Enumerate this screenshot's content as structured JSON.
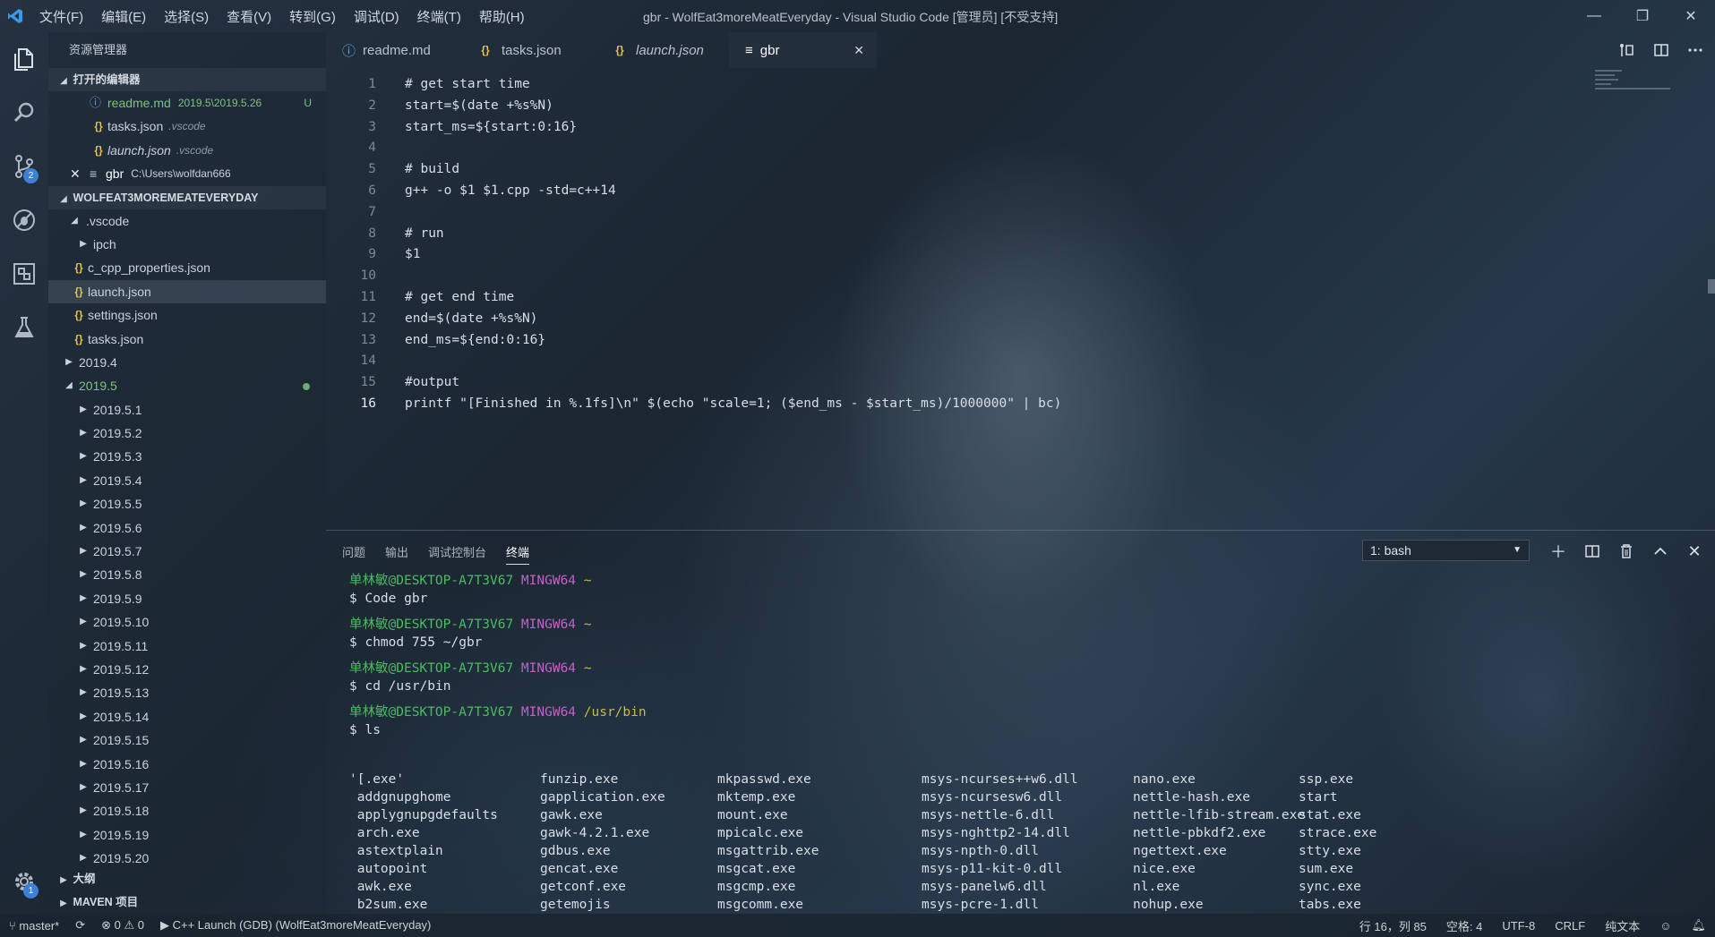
{
  "titlebar": {
    "logo": "vscode-logo",
    "menu": [
      "文件(F)",
      "编辑(E)",
      "选择(S)",
      "查看(V)",
      "转到(G)",
      "调试(D)",
      "终端(T)",
      "帮助(H)"
    ],
    "title": "gbr - WolfEat3moreMeatEveryday - Visual Studio Code [管理员] [不受支持]",
    "win": [
      "—",
      "❐",
      "✕"
    ]
  },
  "activity": {
    "scm_badge": "2",
    "settings_badge": "1"
  },
  "sidebar": {
    "header": "资源管理器",
    "open_editors": {
      "label": "打开的编辑器",
      "items": [
        {
          "name": "readme.md",
          "detail": "2019.5\\2019.5.26",
          "flag": "U"
        },
        {
          "name": "tasks.json",
          "detail": ".vscode"
        },
        {
          "name": "launch.json",
          "detail": ".vscode"
        },
        {
          "name": "gbr",
          "detail": "C:\\Users\\wolfdan666",
          "close": "✕"
        }
      ]
    },
    "workspace": {
      "label": "WOLFEAT3MOREMEATEVERYDAY",
      "items": [
        ".vscode",
        "ipch",
        "c_cpp_properties.json",
        "launch.json",
        "settings.json",
        "tasks.json",
        "2019.4",
        "2019.5",
        "2019.5.1",
        "2019.5.2",
        "2019.5.3",
        "2019.5.4",
        "2019.5.5",
        "2019.5.6",
        "2019.5.7",
        "2019.5.8",
        "2019.5.9",
        "2019.5.10",
        "2019.5.11",
        "2019.5.12",
        "2019.5.13",
        "2019.5.14",
        "2019.5.15",
        "2019.5.16",
        "2019.5.17",
        "2019.5.18",
        "2019.5.19",
        "2019.5.20"
      ]
    },
    "outline": "大纲",
    "maven": "MAVEN 项目"
  },
  "tabs": [
    {
      "label": "readme.md",
      "icon": "info-icon"
    },
    {
      "label": "tasks.json",
      "icon": "json-icon"
    },
    {
      "label": "launch.json",
      "icon": "json-icon"
    },
    {
      "label": "gbr",
      "icon": "file-icon",
      "close": "✕"
    }
  ],
  "editor": {
    "lines": [
      "# get start time",
      "start=$(date +%s%N)",
      "start_ms=${start:0:16}",
      "",
      "# build",
      "g++ -o $1 $1.cpp -std=c++14",
      "",
      "# run",
      "$1",
      "",
      "# get end time",
      "end=$(date +%s%N)",
      "end_ms=${end:0:16}",
      "",
      "#output",
      "printf \"[Finished in %.1fs]\\n\" $(echo \"scale=1; ($end_ms - $start_ms)/1000000\" | bc)"
    ],
    "numbers": [
      "1",
      "2",
      "3",
      "4",
      "5",
      "6",
      "7",
      "8",
      "9",
      "10",
      "11",
      "12",
      "13",
      "14",
      "15",
      "16"
    ]
  },
  "panel": {
    "tabs": [
      "问题",
      "输出",
      "调试控制台",
      "终端"
    ],
    "terminal_select": "1: bash",
    "prompt_user": "单林敏@DESKTOP-A7T3V67",
    "prompt_env": "MINGW64",
    "sessions": [
      {
        "dir": "~",
        "cmd": "$ Code gbr"
      },
      {
        "dir": "~",
        "cmd": "$ chmod 755 ~/gbr"
      },
      {
        "dir": "~",
        "cmd": "$ cd /usr/bin"
      },
      {
        "dir": "/usr/bin",
        "cmd": "$ ls"
      }
    ],
    "ls": [
      [
        "'[.exe'",
        " addgnupghome",
        " applygnupgdefaults",
        " arch.exe",
        " astextplain",
        " autopoint",
        " awk.exe",
        " b2sum.exe"
      ],
      [
        "funzip.exe",
        "gapplication.exe",
        "gawk.exe",
        "gawk-4.2.1.exe",
        "gdbus.exe",
        "gencat.exe",
        "getconf.exe",
        "getemojis"
      ],
      [
        "mkpasswd.exe",
        "mktemp.exe",
        "mount.exe",
        "mpicalc.exe",
        "msgattrib.exe",
        "msgcat.exe",
        "msgcmp.exe",
        "msgcomm.exe"
      ],
      [
        "msys-ncurses++w6.dll",
        "msys-ncursesw6.dll",
        "msys-nettle-6.dll",
        "msys-nghttp2-14.dll",
        "msys-npth-0.dll",
        "msys-p11-kit-0.dll",
        "msys-panelw6.dll",
        "msys-pcre-1.dll"
      ],
      [
        "nano.exe",
        "nettle-hash.exe",
        "nettle-lfib-stream.exe",
        "nettle-pbkdf2.exe",
        "ngettext.exe",
        "nice.exe",
        "nl.exe",
        "nohup.exe"
      ],
      [
        "ssp.exe",
        "start",
        "stat.exe",
        "strace.exe",
        "stty.exe",
        "sum.exe",
        "sync.exe",
        "tabs.exe"
      ]
    ]
  },
  "status": {
    "branch": "master*",
    "errors": "0",
    "warnings": "0",
    "launch": "C++ Launch (GDB) (WolfEat3moreMeatEveryday)",
    "position": "行 16，列 85",
    "spaces": "空格: 4",
    "encoding": "UTF-8",
    "eol": "CRLF",
    "mode": "纯文本"
  }
}
